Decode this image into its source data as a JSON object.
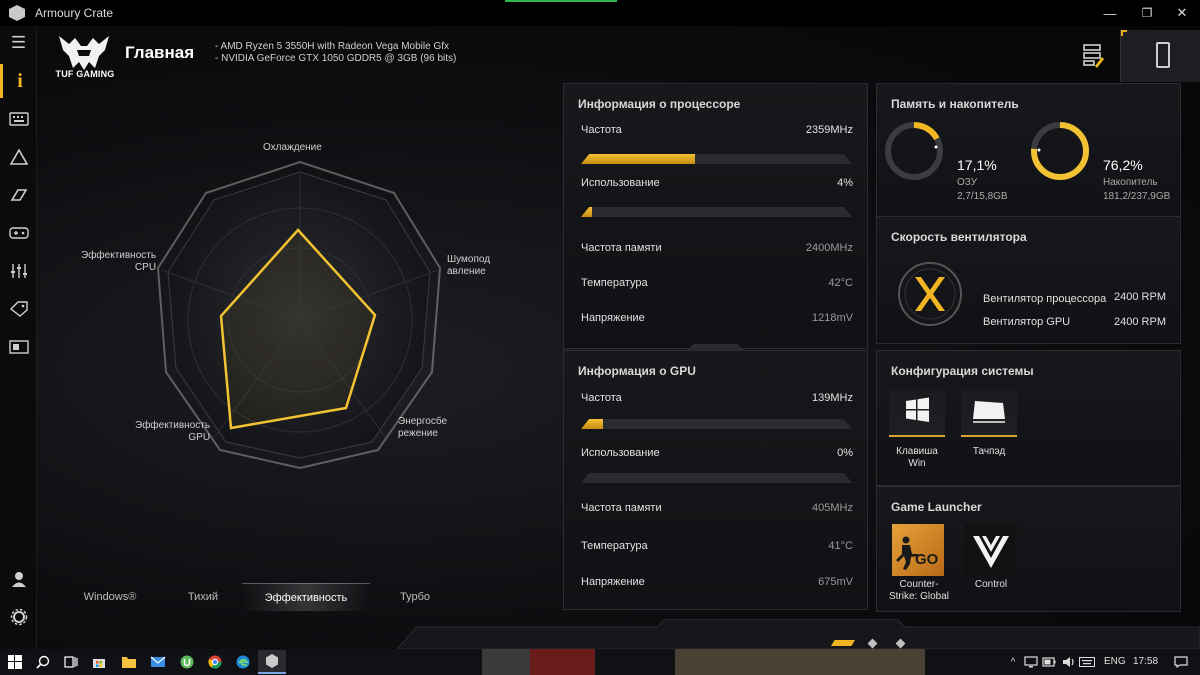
{
  "window": {
    "title": "Armoury Crate",
    "minimize": "—",
    "maximize": "❐",
    "close": "✕"
  },
  "header": {
    "brand": "TUF GAMING",
    "page_title": "Главная",
    "specs": [
      "-  AMD Ryzen 5 3550H with Radeon Vega Mobile Gfx",
      "-  NVIDIA GeForce GTX 1050 GDDR5 @ 3GB (96 bits)"
    ]
  },
  "radar": {
    "labels": {
      "cooling": "Охлаждение",
      "noise": "Шумопод\nавление",
      "energy": "Энергосбе\nрежение",
      "gpu": "Эффективность\nGPU",
      "cpu": "Эффективность\nCPU"
    }
  },
  "modes": [
    {
      "label": "Windows®",
      "active": false
    },
    {
      "label": "Тихий",
      "active": false
    },
    {
      "label": "Эффективность",
      "active": true
    },
    {
      "label": "Турбо",
      "active": false
    }
  ],
  "cpu": {
    "title": "Информация о процессоре",
    "freq_label": "Частота",
    "freq_value": "2359MHz",
    "freq_bar": 0.42,
    "usage_label": "Использование",
    "usage_value": "4%",
    "usage_bar": 0.04,
    "mem_label": "Частота памяти",
    "mem_value": "2400MHz",
    "temp_label": "Температура",
    "temp_value": "42°C",
    "volt_label": "Напряжение",
    "volt_value": "1218mV"
  },
  "gpu": {
    "title": "Информация о GPU",
    "freq_label": "Частота",
    "freq_value": "139MHz",
    "freq_bar": 0.08,
    "usage_label": "Использование",
    "usage_value": "0%",
    "usage_bar": 0.0,
    "mem_label": "Частота памяти",
    "mem_value": "405MHz",
    "temp_label": "Температура",
    "temp_value": "41°C",
    "volt_label": "Напряжение",
    "volt_value": "675mV"
  },
  "memory": {
    "title": "Память и накопитель",
    "ram_pct": "17,1%",
    "ram_label": "ОЗУ",
    "ram_detail": "2,7/15,8GB",
    "ram_fraction": 0.171,
    "disk_pct": "76,2%",
    "disk_label": "Накопитель",
    "disk_detail": "181,2/237,9GB",
    "disk_fraction": 0.762
  },
  "fans": {
    "title": "Скорость вентилятора",
    "cpu_label": "Вентилятор процессора",
    "cpu_value": "2400 RPM",
    "gpu_label": "Вентилятор GPU",
    "gpu_value": "2400 RPM"
  },
  "config": {
    "title": "Конфигурация системы",
    "win_key": "Клавиша\nWin",
    "touchpad": "Тачпэд"
  },
  "games": {
    "title": "Game Launcher",
    "csgo": "Counter-\nStrike: Global",
    "csgo_logo": "GO",
    "control": "Control"
  },
  "taskbar": {
    "lang": "ENG",
    "time": "17:58"
  },
  "colors": {
    "accent": "#f2b622",
    "panel": "#17181b",
    "border": "#2a2c30"
  }
}
